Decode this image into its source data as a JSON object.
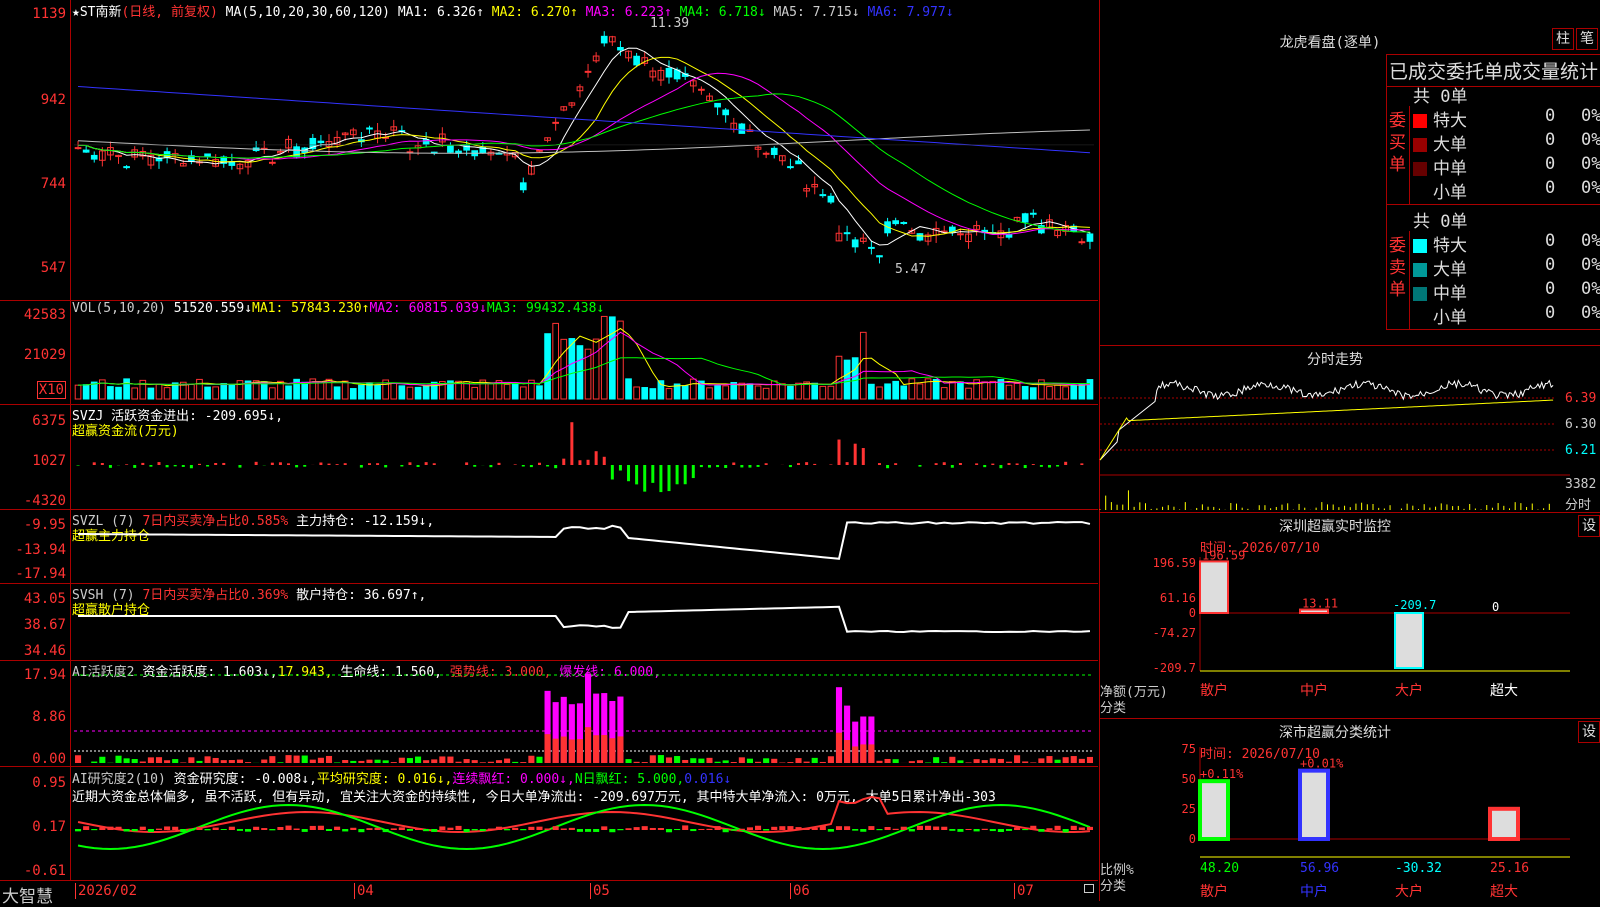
{
  "main_chart": {
    "title_star": "★",
    "stock_name": "ST南新",
    "period": "(日线, 前复权)",
    "ma_def": "MA(5,10,20,30,60,120)",
    "ma": [
      {
        "label": "MA1: 6.326↑",
        "color": "#ffffff"
      },
      {
        "label": "MA2: 6.270↑",
        "color": "#ffff00"
      },
      {
        "label": "MA3: 6.223↑",
        "color": "#ff00ff"
      },
      {
        "label": "MA4: 6.718↓",
        "color": "#00ff00"
      },
      {
        "label": "MA5: 7.715↓",
        "color": "#c0c0c0"
      },
      {
        "label": "MA6: 7.977↓",
        "color": "#3333ff"
      }
    ],
    "y_labels": [
      "1139",
      "942",
      "744",
      "547"
    ],
    "high_label": "11.39",
    "low_label": "5.47"
  },
  "vol_panel": {
    "def": "VOL(5,10,20)",
    "value": "51520.559↓",
    "ma1": "MA1: 57843.230↑",
    "ma2": "MA2: 60815.039↓",
    "ma3": "MA3: 99432.438↓",
    "y_labels": [
      "42583",
      "21029"
    ],
    "unit": "X10"
  },
  "svzj_panel": {
    "line1": "SVZJ  活跃资金进出: -209.695↓,",
    "line2": "超赢资金流(万元)",
    "y_labels": [
      "6375",
      "1027",
      "-4320"
    ]
  },
  "svzl_panel": {
    "def": "SVZL (7)",
    "ratio": "7日内买卖净占比0.585%",
    "value": "主力持仓: -12.159↓,",
    "line2": "超赢主力持仓",
    "y_labels": [
      "-9.95",
      "-13.94",
      "-17.94"
    ]
  },
  "svsh_panel": {
    "def": "SVSH (7)",
    "ratio": "7日内买卖净占比0.369%",
    "value": "散户持仓: 36.697↑,",
    "line2": "超赢散户持仓",
    "y_labels": [
      "43.05",
      "38.67",
      "34.46"
    ]
  },
  "ai_active_panel": {
    "def": "AI活跃度2",
    "v1": "资金活跃度: 1.603↓,",
    "v2": "17.943,",
    "v3": "生命线: 1.560,",
    "v4": "强势线: 3.000,",
    "v5": "爆发线: 6.000,",
    "y_labels": [
      "17.94",
      "8.86",
      "0.00"
    ]
  },
  "ai_research_panel": {
    "def": "AI研究度2(10)",
    "v1": "资金研究度: -0.008↓,",
    "v2": "平均研究度: 0.016↓,",
    "v3": "连续飘红: 0.000↓,",
    "v4": "N日飘红: 5.000,",
    "v5": "0.016↓",
    "comment": "近期大资金总体偏多, 虽不活跃, 但有异动, 宜关注大资金的持续性, 今日大单净流出: -209.697万元, 其中特大单净流入: 0万元, 大单5日累计净出-303",
    "y_labels": [
      "0.95",
      "0.17",
      "-0.61"
    ]
  },
  "bottom_bar": {
    "brand": "大智慧",
    "dates": [
      "2026/02",
      "04",
      "05",
      "06",
      "07"
    ]
  },
  "lhb": {
    "title": "龙虎看盘(逐单)",
    "btn1": "柱",
    "btn2": "笔",
    "subtitle": "已成交委托单成交量统计",
    "buy": {
      "side": "委买单",
      "total": "共 0单",
      "rows": [
        {
          "name": "特大",
          "count": "0",
          "pct": "0%",
          "color": "#ff0000"
        },
        {
          "name": "大单",
          "count": "0",
          "pct": "0%",
          "color": "#990000"
        },
        {
          "name": "中单",
          "count": "0",
          "pct": "0%",
          "color": "#660000"
        },
        {
          "name": "小单",
          "count": "0",
          "pct": "0%",
          "color": "#000000"
        }
      ]
    },
    "sell": {
      "side": "委卖单",
      "total": "共 0单",
      "rows": [
        {
          "name": "特大",
          "count": "0",
          "pct": "0%",
          "color": "#00ffff"
        },
        {
          "name": "大单",
          "count": "0",
          "pct": "0%",
          "color": "#009999"
        },
        {
          "name": "中单",
          "count": "0",
          "pct": "0%",
          "color": "#007777"
        },
        {
          "name": "小单",
          "count": "0",
          "pct": "0%",
          "color": "#000000"
        }
      ]
    }
  },
  "intraday": {
    "title": "分时走势",
    "prices": [
      "6.39",
      "6.30",
      "6.21"
    ],
    "vol": "3382",
    "vol_unit": "分时"
  },
  "sz_monitor": {
    "title": "深圳超赢实时监控",
    "set": "设",
    "time": "时间: 2026/07/10",
    "y_labels": [
      "196.59",
      "61.16",
      "0",
      "-74.27",
      "-209.7"
    ],
    "axis_title": "净额(万元)",
    "axis_title2": "分类",
    "bars": [
      {
        "cat": "散户",
        "value": 196.59,
        "label": "196.59",
        "label_color": "#ff3333",
        "cat_color": "#ff3333"
      },
      {
        "cat": "中户",
        "value": 13.11,
        "label": "13.11",
        "label_color": "#ff3333",
        "cat_color": "#ff3333"
      },
      {
        "cat": "大户",
        "value": -209.7,
        "label": "-209.7",
        "label_color": "#00ffff",
        "cat_color": "#ff3333"
      },
      {
        "cat": "超大",
        "value": 0,
        "label": "0",
        "label_color": "#ffffff",
        "cat_color": "#ffffff"
      }
    ]
  },
  "sz_class": {
    "title": "深市超赢分类统计",
    "set": "设",
    "time": "时间: 2026/07/10",
    "y_labels": [
      "75",
      "50",
      "25",
      "0"
    ],
    "axis_title": "比例%",
    "axis_title2": "分类",
    "bars": [
      {
        "cat": "散户",
        "value": 48.2,
        "top": "+0.11%",
        "bottom": "48.20",
        "bottom_color": "#00ff00",
        "cat_color": "#ff3333"
      },
      {
        "cat": "中户",
        "value": 56.96,
        "top": "+0.01%",
        "bottom": "56.96",
        "bottom_color": "#3333ff",
        "cat_color": "#3333ff"
      },
      {
        "cat": "大户",
        "value": -30.32,
        "top": "",
        "bottom": "-30.32",
        "bottom_color": "#00ffff",
        "cat_color": "#ff3333"
      },
      {
        "cat": "超大",
        "value": 25.16,
        "top": "",
        "bottom": "25.16",
        "bottom_color": "#ff3333",
        "cat_color": "#ff3333"
      }
    ]
  },
  "colors": {
    "up": "#ff3333",
    "down": "#00ffff",
    "axis": "#aa0000"
  }
}
